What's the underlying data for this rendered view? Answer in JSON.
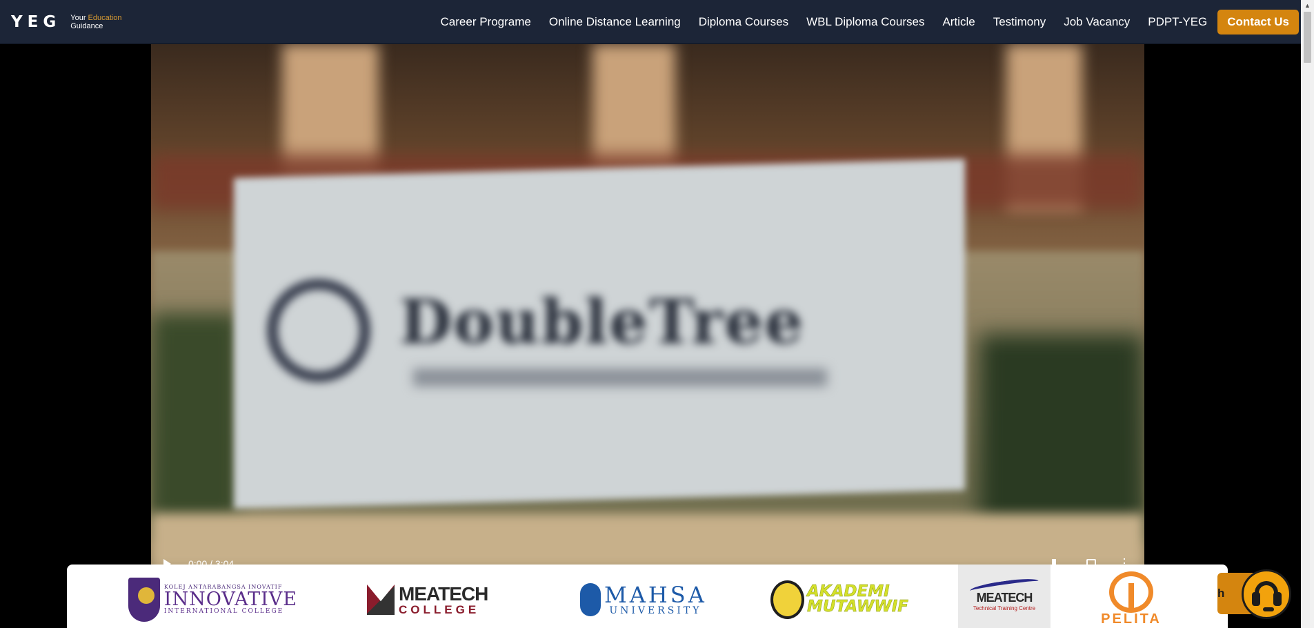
{
  "header": {
    "brand_mark": "YEG",
    "tagline_your": "Your",
    "tagline_education": "Education",
    "tagline_guidance": "Guidance",
    "nav": [
      {
        "label": "Career Programe"
      },
      {
        "label": "Online Distance Learning"
      },
      {
        "label": "Diploma Courses"
      },
      {
        "label": "WBL Diploma Courses"
      },
      {
        "label": "Article"
      },
      {
        "label": "Testimony"
      },
      {
        "label": "Job Vacancy"
      },
      {
        "label": "PDPT-YEG"
      }
    ],
    "contact_label": "Contact Us",
    "colors": {
      "header_bg": "#1c2537",
      "accent": "#d4850f"
    }
  },
  "video": {
    "time": "0:00 / 3:04",
    "sign_text": "DoubleTree"
  },
  "partners": {
    "innovative": {
      "small": "KOLEJ ANTARABANGSA INOVATIF",
      "name": "INNOVATIVE",
      "sub": "INTERNATIONAL COLLEGE"
    },
    "meatech_college": {
      "name": "MEATECH",
      "sub": "COLLEGE"
    },
    "mahsa": {
      "name": "MAHSA",
      "sub": "UNIVERSITY"
    },
    "akademi": {
      "line1": "AKADEMI",
      "line2": "MUTAWWIF"
    },
    "meatech_ttc": {
      "name": "MEATECH",
      "sub": "Technical Training Centre"
    },
    "pelita": {
      "name": "PELITA"
    }
  },
  "chat": {
    "pill_text": "h",
    "icon": "headset-icon"
  }
}
